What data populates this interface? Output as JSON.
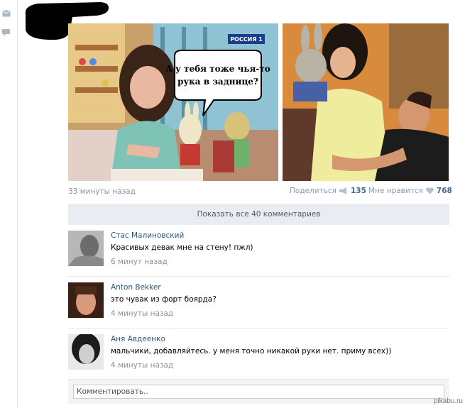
{
  "post": {
    "image1_caption": "А у тебя тоже чья-то рука в заднице?",
    "channel_logo": "РОССИЯ 1",
    "time": "33 минуты назад",
    "share_label": "Поделиться",
    "share_count": "135",
    "like_label": "Мне нравится",
    "like_count": "768"
  },
  "comments_header": {
    "show_all": "Показать все 40 комментариев"
  },
  "comments": [
    {
      "author": "Стас Малиновский",
      "text": "Красивых девак мне на стену! пжл)",
      "time": "6 минут назад"
    },
    {
      "author": "Anton Bekker",
      "text": "это чувак из форт боярда?",
      "time": "4 минуты назад"
    },
    {
      "author": "Аня Авдеенко",
      "text": "мальчики, добавляйтесь. у меня точно никакой руки нет. приму всех))",
      "time": "4 минуты назад"
    }
  ],
  "reply": {
    "placeholder": "Комментировать.."
  },
  "watermark": "pikabu.ru",
  "icons": [
    "mail-icon",
    "comment-icon",
    "share-megaphone-icon",
    "heart-icon"
  ],
  "colors": {
    "link": "#2b587a",
    "counter": "#45688e",
    "muted": "#8a93a0",
    "bar": "#e9edf1"
  }
}
